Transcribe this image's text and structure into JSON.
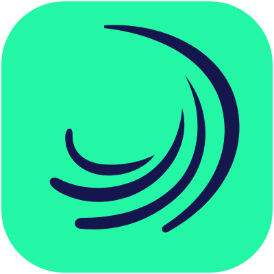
{
  "icon": {
    "name": "swirl-logo-icon",
    "colors": {
      "background": "#23F7A6",
      "stroke": "#16164F",
      "page": "#ffffff"
    }
  }
}
